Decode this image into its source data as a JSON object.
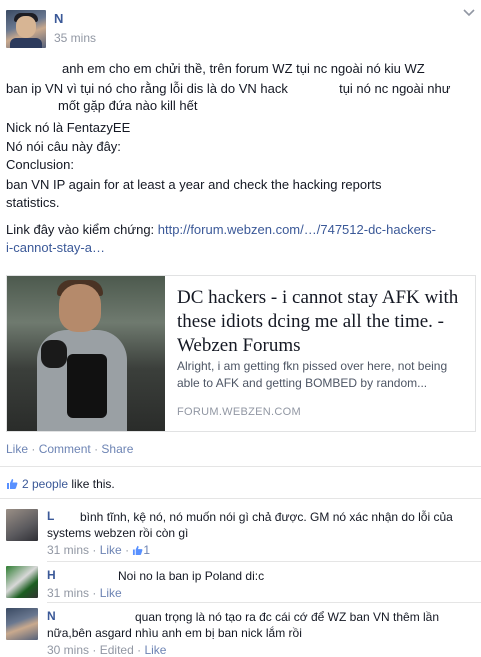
{
  "post": {
    "author": "N",
    "time": "35 mins",
    "lines": [
      "anh em cho em chửi thề, trên forum WZ tụi nc ngoài nó kiu WZ",
      "ban ip VN vì tụi nó cho rằng lỗi dis là do VN hack",
      "tụi nó nc ngoài như",
      "mốt gặp đứa nào kill hết",
      "Nick nó là FentazyEE",
      "Nó nói câu này đây:",
      "Conclusion:",
      "ban VN IP again for at least a year and check the hacking reports",
      "statistics."
    ],
    "link_prefix": "Link đây vào kiểm chứng:",
    "link_url_1": "http://forum.webzen.com/…/747512-dc-hackers-",
    "link_url_2": "i-cannot-stay-a…",
    "card": {
      "title": "DC hackers - i cannot stay AFK with these idiots dcing me all the time. - Webzen Forums",
      "description": "Alright, i am getting fkn pissed over here, not being able to AFK and getting BOMBED by random...",
      "source": "FORUM.WEBZEN.COM"
    },
    "actions": {
      "like": "Like",
      "comment": "Comment",
      "share": "Share",
      "sep": "·"
    },
    "likes": {
      "count_text": "2 people",
      "suffix": "like this."
    }
  },
  "comments": [
    {
      "name": "L",
      "text": "bình tĩnh, kệ nó, nó muốn nói gì chả được. GM nó xác nhận do lỗi của systems webzen rồi còn gì",
      "time": "31 mins",
      "like": "Like",
      "like_count": "1"
    },
    {
      "name": "H",
      "text": "Noi no la ban ip Poland di:c",
      "time": "31 mins",
      "like": "Like"
    },
    {
      "name": "N",
      "text": "quan trọng là nó tạo ra đc cái cớ để WZ ban VN thêm lần nữa,bên asgard nhìu anh em bị ban nick lắm rồi",
      "time": "30 mins",
      "edited": "Edited",
      "like": "Like"
    }
  ],
  "colors": {
    "link": "#3b5998",
    "meta": "#9197a3",
    "text": "#141823"
  }
}
